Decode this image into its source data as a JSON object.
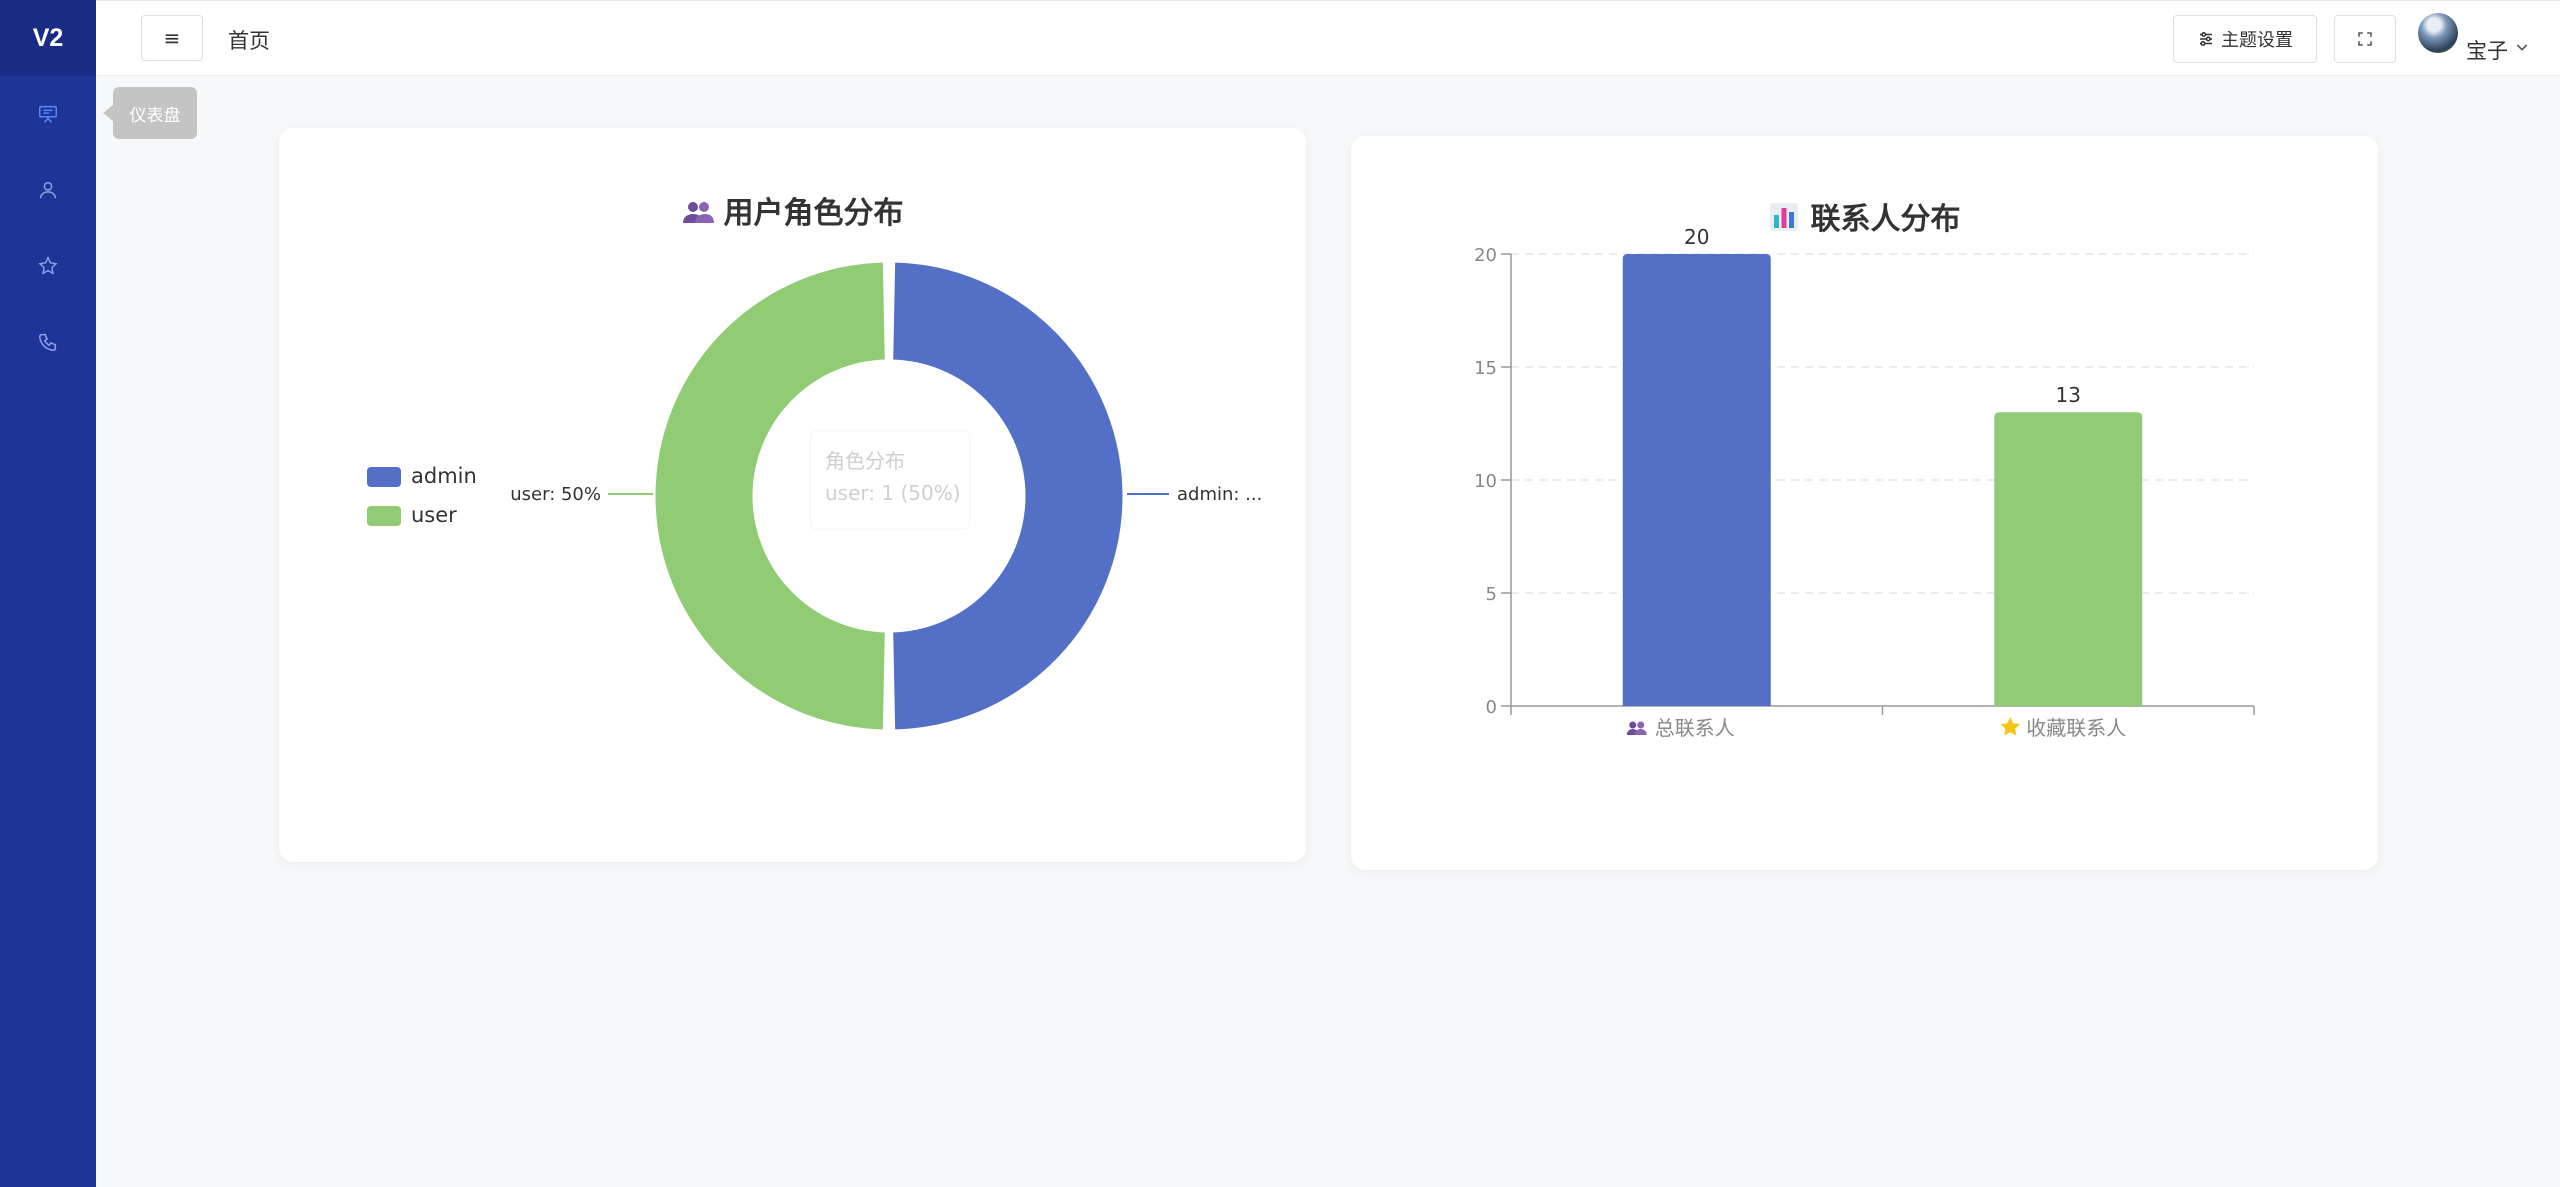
{
  "sidebar": {
    "logo": "V2",
    "items": [
      {
        "icon": "presentation-board-icon",
        "active": true
      },
      {
        "icon": "user-icon",
        "active": false
      },
      {
        "icon": "star-icon",
        "active": false
      },
      {
        "icon": "phone-icon",
        "active": false
      }
    ],
    "tooltip": "仪表盘"
  },
  "header": {
    "menu_glyph": "≡",
    "breadcrumb": "首页",
    "theme_label": "主题设置",
    "user_name": "宝子"
  },
  "colors": {
    "blue": "#5470c6",
    "green": "#91cc75",
    "sidebar": "#1f3497"
  },
  "pie_card": {
    "title": "用户角色分布",
    "legend": [
      "admin",
      "user"
    ],
    "label_user": "user: 50%",
    "label_admin": "admin: ...",
    "tooltip_title": "角色分布",
    "tooltip_value": "user: 1 (50%)"
  },
  "bar_card": {
    "title": "联系人分布"
  },
  "chart_data": [
    {
      "type": "pie",
      "title": "用户角色分布",
      "categories": [
        "admin",
        "user"
      ],
      "values": [
        1,
        1
      ],
      "percent": [
        50,
        50
      ],
      "legend": "left"
    },
    {
      "type": "bar",
      "title": "联系人分布",
      "categories": [
        "总联系人",
        "收藏联系人"
      ],
      "values": [
        20,
        13
      ],
      "ylim": [
        0,
        20
      ],
      "yticks": [
        0,
        5,
        10,
        15,
        20
      ],
      "grid": true
    }
  ]
}
